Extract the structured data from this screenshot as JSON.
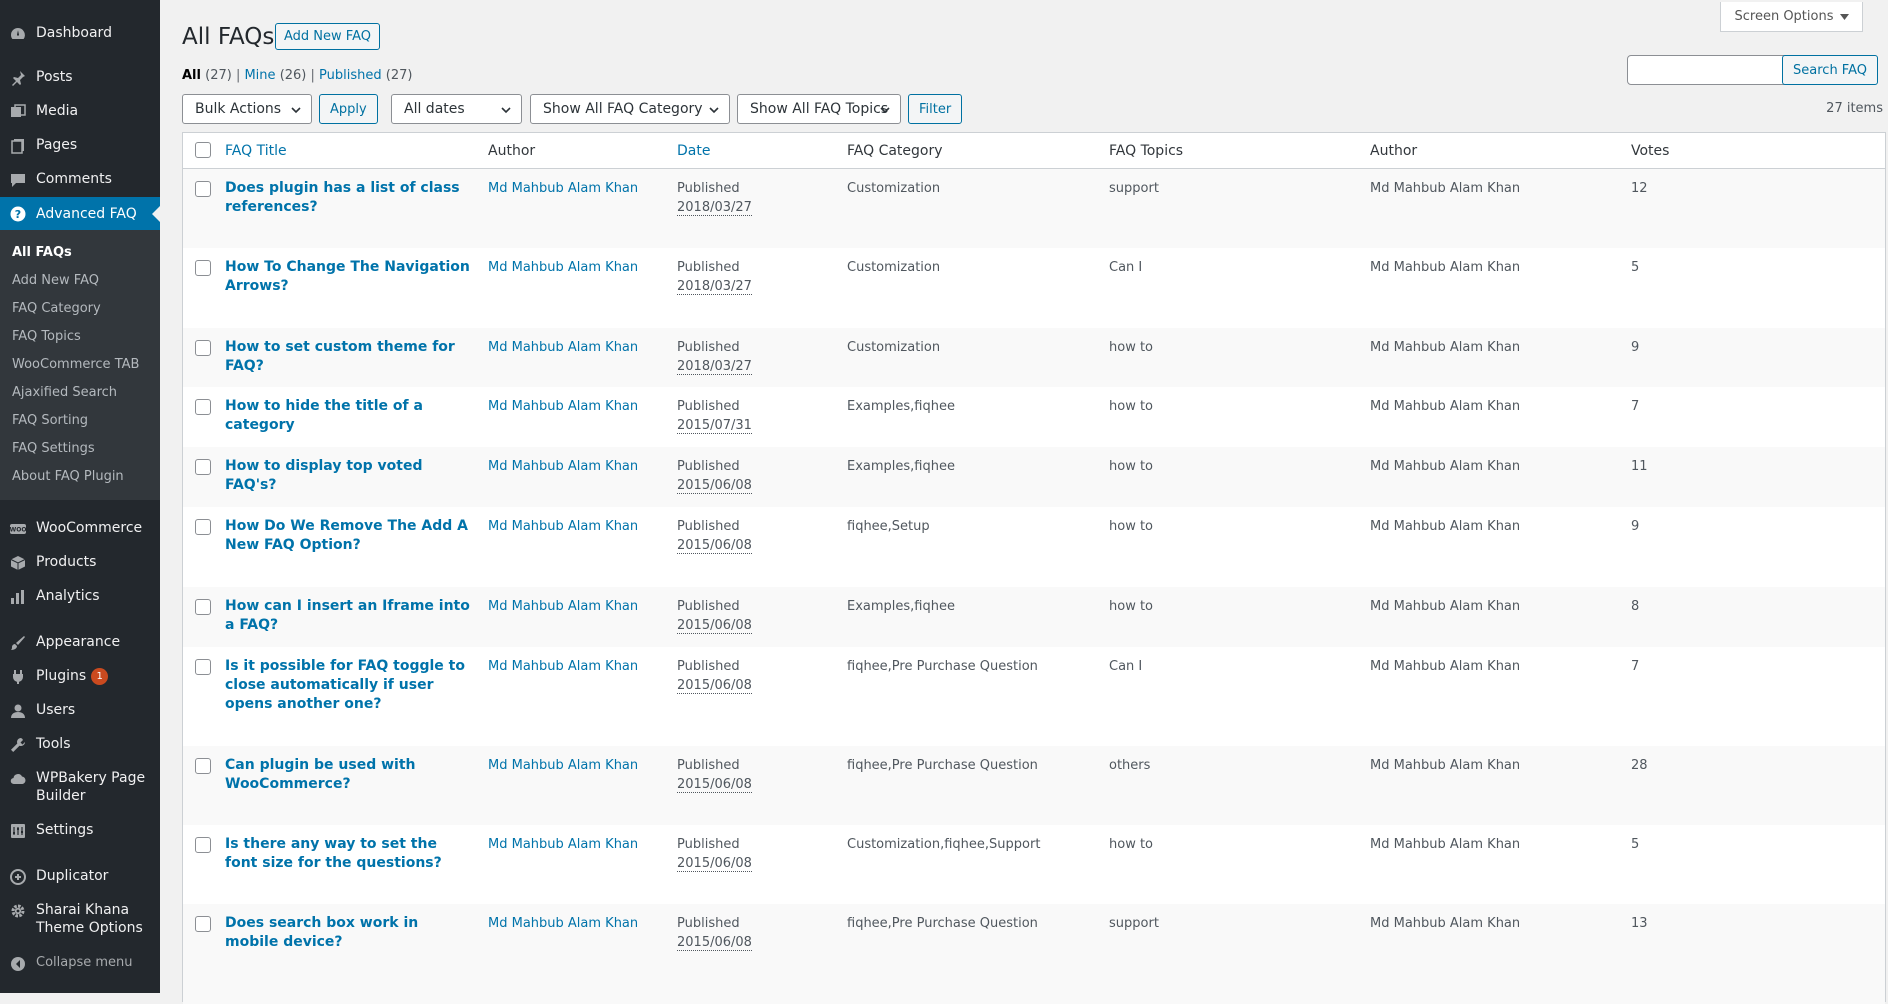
{
  "sidebar": {
    "menu": [
      {
        "label": "Dashboard",
        "icon": "dashboard-icon"
      },
      {
        "label": "Posts",
        "icon": "pin-icon"
      },
      {
        "label": "Media",
        "icon": "media-icon"
      },
      {
        "label": "Pages",
        "icon": "pages-icon"
      },
      {
        "label": "Comments",
        "icon": "comment-icon"
      },
      {
        "label": "Advanced FAQ",
        "icon": "help-icon"
      },
      {
        "label": "WooCommerce",
        "icon": "woocommerce-icon"
      },
      {
        "label": "Products",
        "icon": "products-icon"
      },
      {
        "label": "Analytics",
        "icon": "analytics-icon"
      },
      {
        "label": "Appearance",
        "icon": "brush-icon"
      },
      {
        "label": "Plugins",
        "icon": "plugin-icon",
        "badge": "1"
      },
      {
        "label": "Users",
        "icon": "users-icon"
      },
      {
        "label": "Tools",
        "icon": "wrench-icon"
      },
      {
        "label": "WPBakery Page Builder",
        "icon": "cloud-icon"
      },
      {
        "label": "Settings",
        "icon": "settings-icon"
      },
      {
        "label": "Duplicator",
        "icon": "duplicator-icon"
      },
      {
        "label": "Sharai Khana Theme Options",
        "icon": "gear-icon"
      }
    ],
    "submenu": [
      "All FAQs",
      "Add New FAQ",
      "FAQ Category",
      "FAQ Topics",
      "WooCommerce TAB",
      "Ajaxified Search",
      "FAQ Sorting",
      "FAQ Settings",
      "About FAQ Plugin"
    ],
    "collapse_label": "Collapse menu",
    "accent": "#0073aa",
    "background": "#23282d"
  },
  "header": {
    "screen_options": "Screen Options",
    "title": "All FAQs",
    "add_new": "Add New FAQ",
    "views": {
      "all": "All",
      "all_count": "(27)",
      "mine": "Mine",
      "mine_count": "(26)",
      "published": "Published",
      "published_count": "(27)"
    },
    "search_button": "Search FAQ",
    "search_placeholder": ""
  },
  "filters": {
    "bulk_actions": "Bulk Actions",
    "apply": "Apply",
    "dates": "All dates",
    "category": "Show All FAQ Category",
    "topics": "Show All FAQ Topics",
    "filter": "Filter",
    "items_count": "27 items"
  },
  "table": {
    "columns": [
      "FAQ Title",
      "Author",
      "Date",
      "FAQ Category",
      "FAQ Topics",
      "Author",
      "Votes"
    ],
    "rows": [
      {
        "title": "Does plugin has a list of class references?",
        "author": "Md Mahbub Alam Khan",
        "status": "Published",
        "date": "2018/03/27",
        "category": "Customization",
        "topics": "support",
        "author2": "Md Mahbub Alam Khan",
        "votes": "12"
      },
      {
        "title": "How To Change The Navigation Arrows?",
        "author": "Md Mahbub Alam Khan",
        "status": "Published",
        "date": "2018/03/27",
        "category": "Customization",
        "topics": "Can I",
        "author2": "Md Mahbub Alam Khan",
        "votes": "5"
      },
      {
        "title": "How to set custom theme for FAQ?",
        "author": "Md Mahbub Alam Khan",
        "status": "Published",
        "date": "2018/03/27",
        "category": "Customization",
        "topics": "how to",
        "author2": "Md Mahbub Alam Khan",
        "votes": "9"
      },
      {
        "title": "How to hide the title of a category",
        "author": "Md Mahbub Alam Khan",
        "status": "Published",
        "date": "2015/07/31",
        "category": "Examples,fiqhee",
        "topics": "how to",
        "author2": "Md Mahbub Alam Khan",
        "votes": "7"
      },
      {
        "title": "How to display top voted FAQ's?",
        "author": "Md Mahbub Alam Khan",
        "status": "Published",
        "date": "2015/06/08",
        "category": "Examples,fiqhee",
        "topics": "how to",
        "author2": "Md Mahbub Alam Khan",
        "votes": "11"
      },
      {
        "title": "How Do We Remove The Add A New FAQ Option?",
        "author": "Md Mahbub Alam Khan",
        "status": "Published",
        "date": "2015/06/08",
        "category": "fiqhee,Setup",
        "topics": "how to",
        "author2": "Md Mahbub Alam Khan",
        "votes": "9"
      },
      {
        "title": "How can I insert an Iframe into a FAQ?",
        "author": "Md Mahbub Alam Khan",
        "status": "Published",
        "date": "2015/06/08",
        "category": "Examples,fiqhee",
        "topics": "how to",
        "author2": "Md Mahbub Alam Khan",
        "votes": "8"
      },
      {
        "title": "Is it possible for FAQ toggle to close automatically if user opens another one?",
        "author": "Md Mahbub Alam Khan",
        "status": "Published",
        "date": "2015/06/08",
        "category": "fiqhee,Pre Purchase Question",
        "topics": "Can I",
        "author2": "Md Mahbub Alam Khan",
        "votes": "7"
      },
      {
        "title": "Can plugin be used with WooCommerce?",
        "author": "Md Mahbub Alam Khan",
        "status": "Published",
        "date": "2015/06/08",
        "category": "fiqhee,Pre Purchase Question",
        "topics": "others",
        "author2": "Md Mahbub Alam Khan",
        "votes": "28"
      },
      {
        "title": "Is there any way to set the font size for the questions?",
        "author": "Md Mahbub Alam Khan",
        "status": "Published",
        "date": "2015/06/08",
        "category": "Customization,fiqhee,Support",
        "topics": "how to",
        "author2": "Md Mahbub Alam Khan",
        "votes": "5"
      },
      {
        "title": "Does search box work in mobile device?",
        "author": "Md Mahbub Alam Khan",
        "status": "Published",
        "date": "2015/06/08",
        "category": "fiqhee,Pre Purchase Question",
        "topics": "support",
        "author2": "Md Mahbub Alam Khan",
        "votes": "13"
      }
    ]
  }
}
